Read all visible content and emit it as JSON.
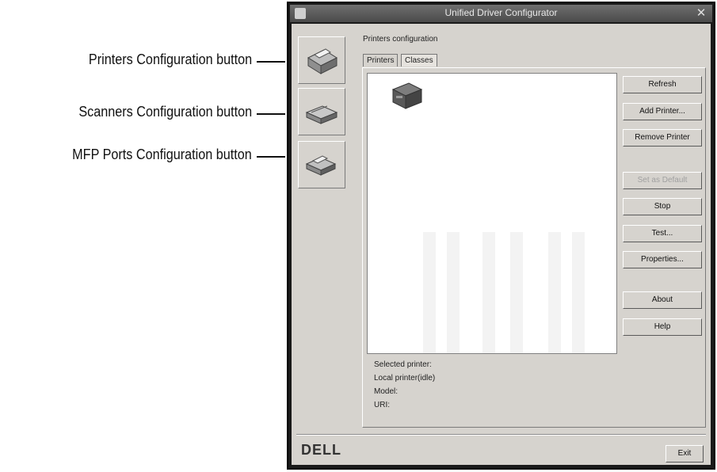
{
  "callouts": [
    {
      "label": "Printers Configuration button"
    },
    {
      "label": "Scanners Configuration button"
    },
    {
      "label": "MFP Ports Configuration button"
    }
  ],
  "window": {
    "title": "Unified Driver Configurator",
    "panel_title": "Printers configuration",
    "tabs": [
      {
        "label": "Printers",
        "active": false
      },
      {
        "label": "Classes",
        "active": true
      }
    ],
    "buttons": {
      "refresh": "Refresh",
      "add_printer": "Add Printer...",
      "remove_printer": "Remove Printer",
      "set_default": "Set as Default",
      "stop": "Stop",
      "test": "Test...",
      "properties": "Properties...",
      "about": "About",
      "help": "Help",
      "exit": "Exit"
    },
    "info": {
      "selected_printer": "Selected printer:",
      "local_printer": "Local printer(idle)",
      "model": "Model:",
      "uri": "URI:"
    },
    "brand": "DELL"
  },
  "icons": {
    "printers_nav": "printer-icon",
    "scanners_nav": "scanner-icon",
    "mfp_nav": "mfp-port-icon",
    "printer_item": "printer-icon",
    "close": "close-icon"
  }
}
